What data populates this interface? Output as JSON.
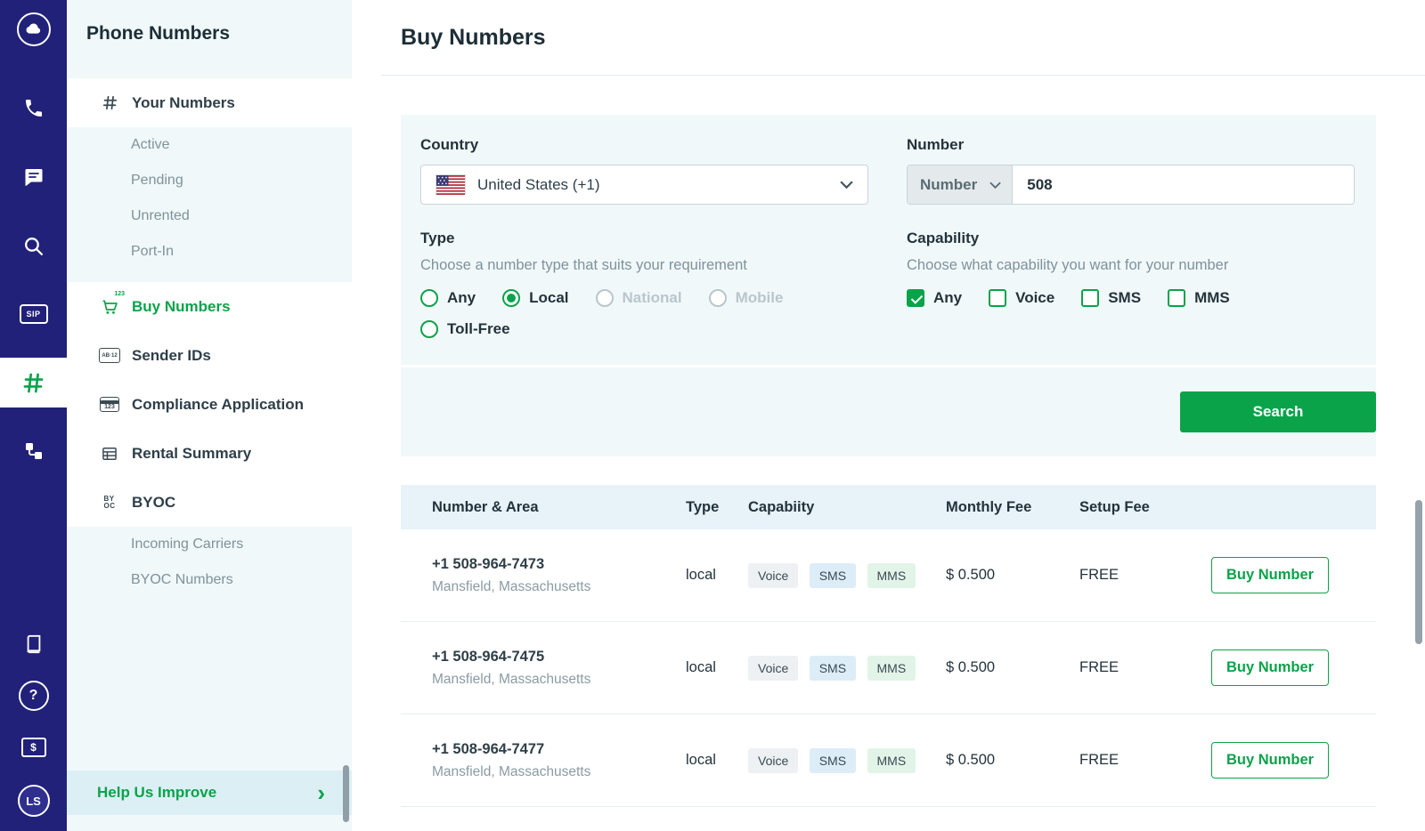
{
  "colors": {
    "accent": "#0BA34A",
    "rail_bg": "#212179",
    "sidebar_bg": "#F0F8F9",
    "panel_bg": "#F1F8FA",
    "table_header_bg": "#E7F3F9"
  },
  "icons": {
    "sip": "SIP",
    "help": "?",
    "billing": "$",
    "avatar": "LS",
    "cart_badge": "123",
    "sender": "AB·12",
    "compliance": "123",
    "byoc_top": "BY",
    "byoc_bottom": "OC",
    "chevron_right": "›"
  },
  "sidebar": {
    "title": "Phone Numbers",
    "items": [
      {
        "label": "Your Numbers"
      },
      {
        "label": "Active"
      },
      {
        "label": "Pending"
      },
      {
        "label": "Unrented"
      },
      {
        "label": "Port-In"
      },
      {
        "label": "Buy Numbers"
      },
      {
        "label": "Sender IDs"
      },
      {
        "label": "Compliance Application"
      },
      {
        "label": "Rental Summary"
      },
      {
        "label": "BYOC"
      },
      {
        "label": "Incoming Carriers"
      },
      {
        "label": "BYOC Numbers"
      }
    ],
    "help_label": "Help Us Improve"
  },
  "header": {
    "title": "Buy Numbers"
  },
  "form": {
    "country": {
      "label": "Country",
      "value": "United States (+1)"
    },
    "number": {
      "label": "Number",
      "mode": "Number",
      "value": "508"
    },
    "type": {
      "label": "Type",
      "subtitle": "Choose a number type that suits your requirement",
      "options": [
        {
          "label": "Any",
          "state": "unchecked"
        },
        {
          "label": "Local",
          "state": "selected"
        },
        {
          "label": "National",
          "state": "disabled"
        },
        {
          "label": "Mobile",
          "state": "disabled"
        },
        {
          "label": "Toll-Free",
          "state": "unchecked"
        }
      ]
    },
    "capability": {
      "label": "Capability",
      "subtitle": "Choose what capability you want for your number",
      "options": [
        {
          "label": "Any",
          "state": "checked"
        },
        {
          "label": "Voice",
          "state": "unchecked"
        },
        {
          "label": "SMS",
          "state": "unchecked"
        },
        {
          "label": "MMS",
          "state": "unchecked"
        }
      ]
    },
    "search_label": "Search"
  },
  "table": {
    "headers": [
      "Number & Area",
      "Type",
      "Capabiity",
      "Monthly Fee",
      "Setup Fee"
    ],
    "buy_label": "Buy Number",
    "rows": [
      {
        "number": "+1 508-964-7473",
        "area": "Mansfield, Massachusetts",
        "type": "local",
        "capabilities": [
          "Voice",
          "SMS",
          "MMS"
        ],
        "monthly_fee": "$ 0.500",
        "setup_fee": "FREE"
      },
      {
        "number": "+1 508-964-7475",
        "area": "Mansfield, Massachusetts",
        "type": "local",
        "capabilities": [
          "Voice",
          "SMS",
          "MMS"
        ],
        "monthly_fee": "$ 0.500",
        "setup_fee": "FREE"
      },
      {
        "number": "+1 508-964-7477",
        "area": "Mansfield, Massachusetts",
        "type": "local",
        "capabilities": [
          "Voice",
          "SMS",
          "MMS"
        ],
        "monthly_fee": "$ 0.500",
        "setup_fee": "FREE"
      }
    ]
  }
}
